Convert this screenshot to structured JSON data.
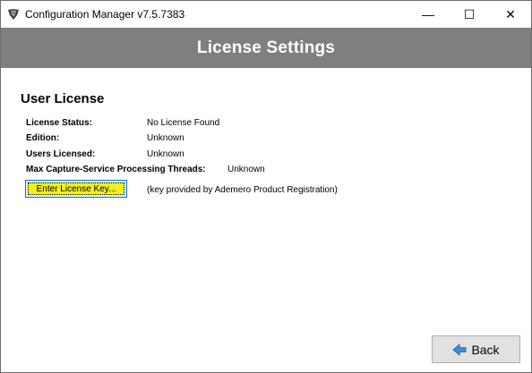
{
  "window": {
    "title": "Configuration Manager v7.5.7383",
    "minimize_glyph": "—",
    "maximize_glyph": "☐",
    "close_glyph": "✕"
  },
  "banner": {
    "title": "License Settings",
    "background_color": "#7f7f7f"
  },
  "user_license": {
    "heading": "User License",
    "fields": [
      {
        "label": "License Status:",
        "value": "No License Found"
      },
      {
        "label": "Edition:",
        "value": "Unknown"
      },
      {
        "label": "Users Licensed:",
        "value": "Unknown"
      },
      {
        "label": "Max Capture-Service Processing Threads:",
        "value": "Unknown"
      }
    ],
    "enter_key_button": {
      "label": "Enter License Key...",
      "highlight_color": "#f2f01a"
    },
    "key_hint": "(key provided by Ademero Product Registration)"
  },
  "footer": {
    "back_button": {
      "label": "Back",
      "icon": "back-arrow-icon"
    }
  }
}
